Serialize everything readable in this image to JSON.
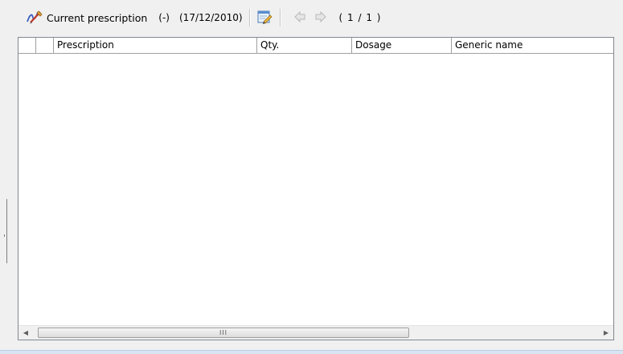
{
  "toolbar": {
    "prescription_icon": "prescription-pen-icon",
    "title": "Current prescription",
    "extra": "(-)",
    "date": "(17/12/2010)",
    "edit_icon": "edit-note-icon",
    "prev_icon": "arrow-left-icon",
    "next_icon": "arrow-right-icon",
    "page_indicator": "( 1 / 1 )"
  },
  "grid": {
    "columns": [
      {
        "label": ""
      },
      {
        "label": ""
      },
      {
        "label": "Prescription"
      },
      {
        "label": "Qty."
      },
      {
        "label": "Dosage"
      },
      {
        "label": "Generic name"
      }
    ],
    "rows": []
  },
  "scrollbar": {
    "grip": "III"
  },
  "colors": {
    "background": "#f0f0f0",
    "grid_border": "#828790",
    "bottom_accent": "#d8e4f2"
  }
}
